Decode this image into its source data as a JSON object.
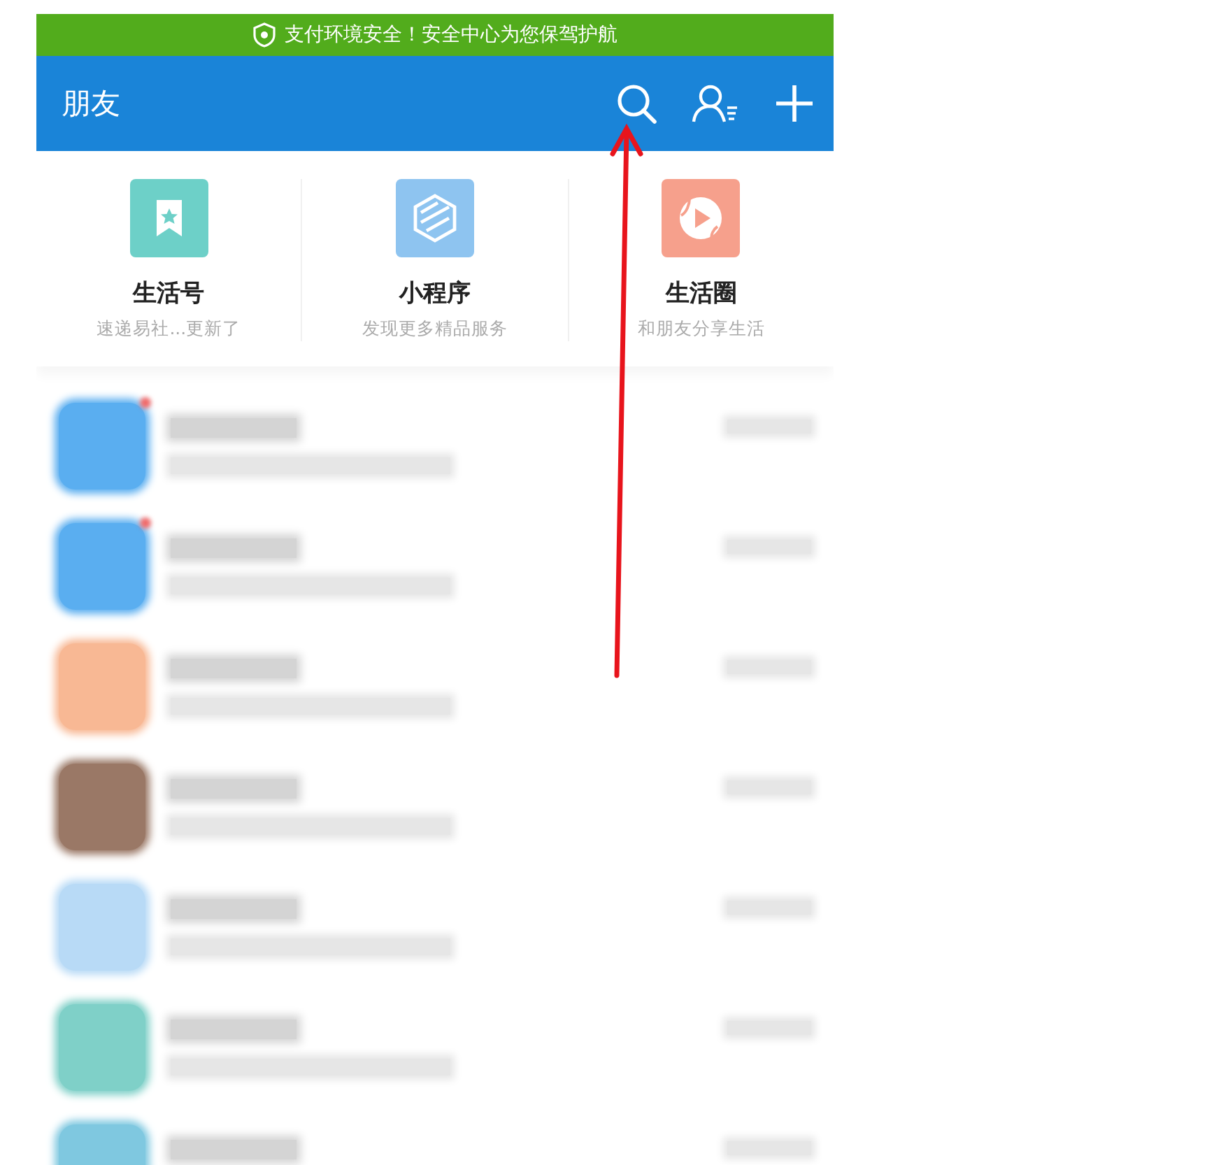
{
  "security_banner": {
    "text": "支付环境安全！安全中心为您保驾护航"
  },
  "header": {
    "title": "朋友"
  },
  "shortcuts": [
    {
      "kind": "bookmark",
      "title": "生活号",
      "subtitle": "速递易社...更新了",
      "color": "#6dd0c8"
    },
    {
      "kind": "hexagon",
      "title": "小程序",
      "subtitle": "发现更多精品服务",
      "color": "#8ec4f0"
    },
    {
      "kind": "play",
      "title": "生活圈",
      "subtitle": "和朋友分享生活",
      "color": "#f6a08c"
    }
  ],
  "conversations": [
    {
      "color": "#5aaef0",
      "unread": true
    },
    {
      "color": "#5aaef0",
      "unread": true
    },
    {
      "color": "#f8b894",
      "unread": false
    },
    {
      "color": "#9a7866",
      "unread": false
    },
    {
      "color": "#b8daf6",
      "unread": false
    },
    {
      "color": "#7fd0c8",
      "unread": false
    },
    {
      "color": "#7fc8e0",
      "unread": false
    }
  ],
  "annotation": {
    "kind": "arrow"
  }
}
